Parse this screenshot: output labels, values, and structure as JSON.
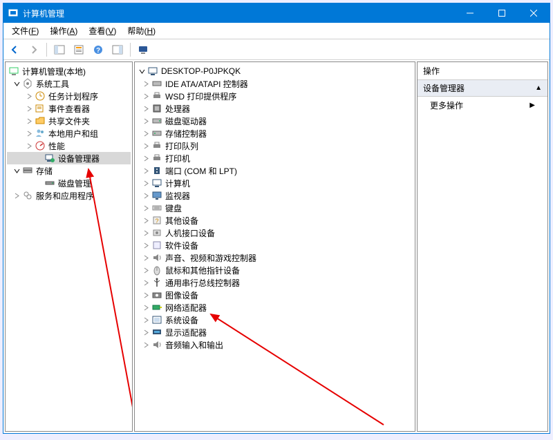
{
  "window": {
    "title": "计算机管理"
  },
  "menubar": {
    "items": [
      {
        "label": "文件",
        "accel": "F"
      },
      {
        "label": "操作",
        "accel": "A"
      },
      {
        "label": "查看",
        "accel": "V"
      },
      {
        "label": "帮助",
        "accel": "H"
      }
    ]
  },
  "toolbar": {
    "icons": [
      "back-arrow-icon",
      "forward-arrow-icon",
      "sep",
      "show-hide-left-pane-icon",
      "properties-icon",
      "help-icon",
      "show-hide-right-pane-icon",
      "sep",
      "monitor-icon"
    ]
  },
  "nav": {
    "root": {
      "label": "计算机管理(本地)",
      "icon": "computer-management-icon",
      "expanded": true
    },
    "children": [
      {
        "label": "系统工具",
        "icon": "system-tools-icon",
        "expanded": true,
        "children": [
          {
            "label": "任务计划程序",
            "icon": "task-scheduler-icon",
            "collapsible": true
          },
          {
            "label": "事件查看器",
            "icon": "event-viewer-icon",
            "collapsible": true
          },
          {
            "label": "共享文件夹",
            "icon": "shared-folders-icon",
            "collapsible": true
          },
          {
            "label": "本地用户和组",
            "icon": "local-users-icon",
            "collapsible": true
          },
          {
            "label": "性能",
            "icon": "performance-icon",
            "collapsible": true
          },
          {
            "label": "设备管理器",
            "icon": "device-manager-icon",
            "selected": true
          }
        ]
      },
      {
        "label": "存储",
        "icon": "storage-icon",
        "expanded": true,
        "children": [
          {
            "label": "磁盘管理",
            "icon": "disk-management-icon"
          }
        ]
      },
      {
        "label": "服务和应用程序",
        "icon": "services-apps-icon",
        "collapsible": true
      }
    ]
  },
  "content": {
    "root": {
      "label": "DESKTOP-P0JPKQK",
      "icon": "computer-icon",
      "expanded": true
    },
    "children": [
      {
        "label": "IDE ATA/ATAPI 控制器",
        "icon": "ide-controller-icon"
      },
      {
        "label": "WSD 打印提供程序",
        "icon": "print-provider-icon"
      },
      {
        "label": "处理器",
        "icon": "processor-icon"
      },
      {
        "label": "磁盘驱动器",
        "icon": "disk-drive-icon"
      },
      {
        "label": "存储控制器",
        "icon": "storage-controller-icon"
      },
      {
        "label": "打印队列",
        "icon": "print-queue-icon"
      },
      {
        "label": "打印机",
        "icon": "printer-icon"
      },
      {
        "label": "端口 (COM 和 LPT)",
        "icon": "ports-icon"
      },
      {
        "label": "计算机",
        "icon": "computer-device-icon"
      },
      {
        "label": "监视器",
        "icon": "monitor-device-icon"
      },
      {
        "label": "键盘",
        "icon": "keyboard-icon"
      },
      {
        "label": "其他设备",
        "icon": "unknown-device-icon"
      },
      {
        "label": "人机接口设备",
        "icon": "hid-icon"
      },
      {
        "label": "软件设备",
        "icon": "software-device-icon"
      },
      {
        "label": "声音、视频和游戏控制器",
        "icon": "sound-controller-icon"
      },
      {
        "label": "鼠标和其他指针设备",
        "icon": "mouse-icon"
      },
      {
        "label": "通用串行总线控制器",
        "icon": "usb-controller-icon"
      },
      {
        "label": "图像设备",
        "icon": "imaging-device-icon"
      },
      {
        "label": "网络适配器",
        "icon": "network-adapter-icon"
      },
      {
        "label": "系统设备",
        "icon": "system-device-icon"
      },
      {
        "label": "显示适配器",
        "icon": "display-adapter-icon"
      },
      {
        "label": "音频输入和输出",
        "icon": "audio-io-icon"
      }
    ]
  },
  "actions": {
    "header": "操作",
    "section_title": "设备管理器",
    "items": [
      {
        "label": "更多操作",
        "has_sub": true
      }
    ]
  },
  "annotations": {
    "arrow1_target": "设备管理器",
    "arrow2_target": "图像设备"
  }
}
